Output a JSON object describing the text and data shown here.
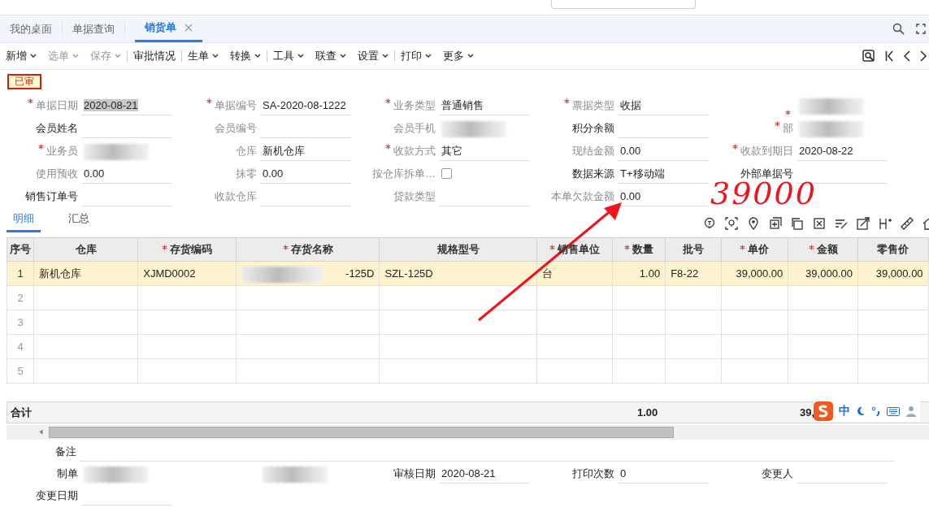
{
  "tabs": [
    {
      "label": "我的桌面",
      "selected": false,
      "closable": false
    },
    {
      "label": "单据查询",
      "selected": false,
      "closable": false
    },
    {
      "label": "销货单",
      "selected": true,
      "closable": true
    }
  ],
  "toolbar": [
    {
      "label": "新增",
      "disabled": false,
      "dropdown": true,
      "separator_before": false
    },
    {
      "label": "选单",
      "disabled": true,
      "dropdown": true,
      "separator_before": false
    },
    {
      "label": "保存",
      "disabled": true,
      "dropdown": true,
      "separator_before": false
    },
    {
      "label": "审批情况",
      "disabled": false,
      "dropdown": false,
      "separator_before": true
    },
    {
      "label": "生单",
      "disabled": false,
      "dropdown": true,
      "separator_before": true
    },
    {
      "label": "转换",
      "disabled": false,
      "dropdown": true,
      "separator_before": false
    },
    {
      "label": "工具",
      "disabled": false,
      "dropdown": true,
      "separator_before": true
    },
    {
      "label": "联查",
      "disabled": false,
      "dropdown": true,
      "separator_before": false
    },
    {
      "label": "设置",
      "disabled": false,
      "dropdown": true,
      "separator_before": false
    },
    {
      "label": "打印",
      "disabled": false,
      "dropdown": true,
      "separator_before": true
    },
    {
      "label": "更多",
      "disabled": false,
      "dropdown": true,
      "separator_before": false
    }
  ],
  "status_badge": "已审",
  "form": [
    {
      "label": "单据日期",
      "required": true,
      "readonly": true,
      "kind": "text",
      "value": "2020-08-21",
      "highlighted": true
    },
    {
      "label": "单据编号",
      "required": true,
      "readonly": true,
      "kind": "text",
      "value": "SA-2020-08-1222"
    },
    {
      "label": "业务类型",
      "required": true,
      "readonly": true,
      "kind": "text",
      "value": "普通销售"
    },
    {
      "label": "票据类型",
      "required": true,
      "readonly": true,
      "kind": "text",
      "value": "收据"
    },
    {
      "required": true,
      "kind": "redacted"
    },
    {
      "label": "会员姓名",
      "required": false,
      "readonly": false,
      "kind": "text"
    },
    {
      "label": "会员编号",
      "required": false,
      "readonly": true,
      "kind": "text"
    },
    {
      "label": "会员手机",
      "required": false,
      "readonly": true,
      "kind": "redacted"
    },
    {
      "label": "积分余额",
      "required": false,
      "readonly": false,
      "kind": "text"
    },
    {
      "label": "部",
      "required": true,
      "readonly": true,
      "kind": "redacted"
    },
    {
      "label": "业务员",
      "required": true,
      "readonly": true,
      "kind": "redacted"
    },
    {
      "label": "仓库",
      "required": false,
      "readonly": true,
      "kind": "text",
      "value": "新机仓库"
    },
    {
      "label": "收款方式",
      "required": true,
      "readonly": true,
      "kind": "text",
      "value": "其它"
    },
    {
      "label": "现结金额",
      "required": false,
      "readonly": true,
      "kind": "text",
      "value": "0.00"
    },
    {
      "label": "收款到期日",
      "required": true,
      "readonly": true,
      "kind": "text",
      "value": "2020-08-22"
    },
    {
      "label": "使用预收",
      "required": false,
      "readonly": true,
      "kind": "text",
      "value": "0.00"
    },
    {
      "label": "抹零",
      "required": false,
      "readonly": true,
      "kind": "text",
      "value": "0.00"
    },
    {
      "label": "按仓库拆单…",
      "required": false,
      "readonly": true,
      "kind": "checkbox",
      "checked": false
    },
    {
      "label": "数据来源",
      "required": false,
      "readonly": false,
      "kind": "text",
      "value": "T+移动端"
    },
    {
      "label": "外部单据号",
      "required": false,
      "readonly": false,
      "kind": "text"
    },
    {
      "label": "销售订单号",
      "required": false,
      "readonly": false,
      "kind": "text"
    },
    {
      "label": "收款仓库",
      "required": false,
      "readonly": true,
      "kind": "text"
    },
    {
      "label": "贷款类型",
      "required": false,
      "readonly": true,
      "kind": "text"
    },
    {
      "label": "本单欠款金额",
      "required": false,
      "readonly": true,
      "kind": "text",
      "value": "0.00"
    }
  ],
  "detail_tabs": [
    {
      "label": "明细",
      "selected": true
    },
    {
      "label": "汇总",
      "selected": false
    }
  ],
  "table": {
    "columns": [
      {
        "label": "序号",
        "required": false
      },
      {
        "label": "仓库",
        "required": false
      },
      {
        "label": "存货编码",
        "required": true
      },
      {
        "label": "存货名称",
        "required": true
      },
      {
        "label": "规格型号",
        "required": false
      },
      {
        "label": "销售单位",
        "required": true
      },
      {
        "label": "数量",
        "required": true
      },
      {
        "label": "批号",
        "required": false
      },
      {
        "label": "单价",
        "required": true
      },
      {
        "label": "金额",
        "required": true
      },
      {
        "label": "零售价",
        "required": false
      }
    ],
    "rows": [
      {
        "selected": true,
        "cells": [
          "1",
          "新机仓库",
          "XJMD0002",
          "-125D",
          "SZL-125D",
          "台",
          "1.00",
          "F8-22",
          "39,000.00",
          "39,000.00",
          "39,000.00"
        ]
      },
      {
        "selected": false,
        "cells": [
          "2"
        ]
      },
      {
        "selected": false,
        "cells": [
          "3"
        ]
      },
      {
        "selected": false,
        "cells": [
          "4"
        ]
      },
      {
        "selected": false,
        "cells": [
          "5"
        ]
      }
    ],
    "totals": {
      "label": "合计",
      "quantity": "1.00",
      "amount": "39,"
    }
  },
  "ime_bar": {
    "label": "中"
  },
  "footer": [
    {
      "label": "备注",
      "kind": "wide"
    },
    {
      "label": "制单",
      "kind": "redacted"
    },
    {
      "kind": "redacted"
    },
    {
      "label": "审核日期",
      "kind": "text",
      "value": "2020-08-21"
    },
    {
      "label": "打印次数",
      "kind": "text",
      "value": "0"
    },
    {
      "label": "变更人",
      "kind": "text"
    },
    {
      "label": "变更日期",
      "kind": "text"
    }
  ],
  "annotation": {
    "text": "39000"
  }
}
